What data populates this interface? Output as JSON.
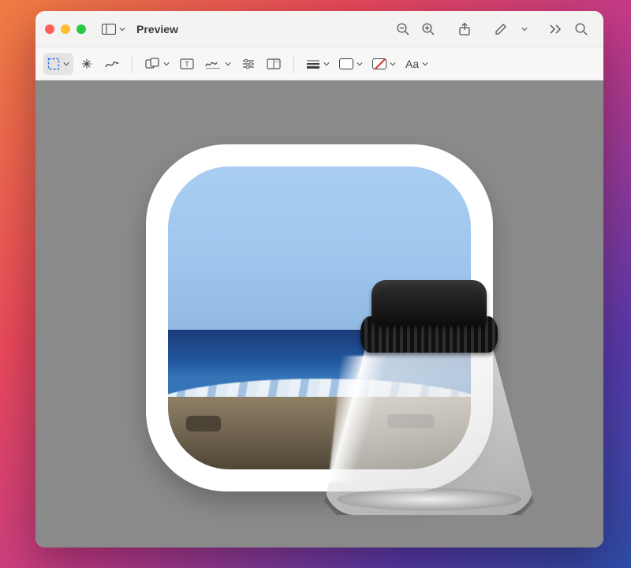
{
  "window": {
    "title": "Preview"
  },
  "titlebar": {
    "sidebar_btn": "sidebar",
    "zoom_out": "zoom-out",
    "zoom_in": "zoom-in",
    "share": "share",
    "markup": "markup-pencil",
    "more": "more",
    "search": "search"
  },
  "markup": {
    "select": "rectangular-selection",
    "instant_alpha": "instant-alpha",
    "sketch": "sketch",
    "shapes": "shapes",
    "text_box": "text",
    "sign": "signature",
    "adjust_color": "adjust-color",
    "adjust_size": "adjust-size",
    "line_style": "line-style",
    "border_color": "border-color",
    "fill_color": "fill-color",
    "text_style_label": "Aa",
    "text_style": "text-style"
  },
  "content": {
    "image_alt": "Preview application icon: rounded white frame showing ocean photo with a magnifying loupe in front"
  }
}
